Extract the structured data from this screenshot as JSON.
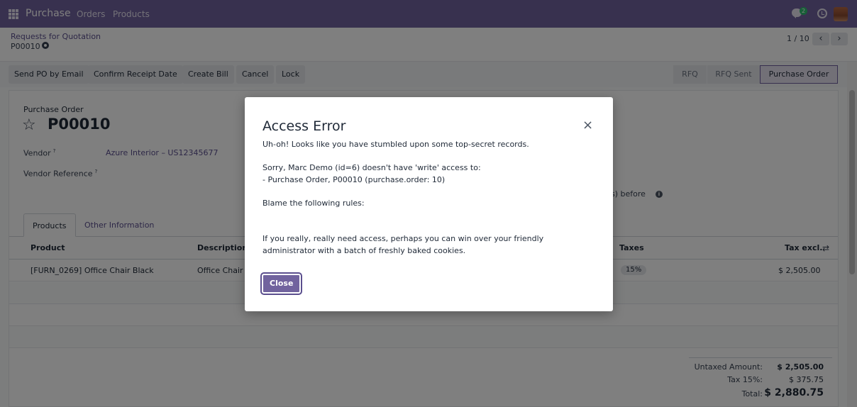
{
  "navbar": {
    "brand": "Purchase",
    "menu": [
      "Orders",
      "Products"
    ],
    "chat_count": "2"
  },
  "control_panel": {
    "breadcrumb": "Requests for Quotation",
    "record_name": "P00010",
    "pager": "1 / 10",
    "prev": "‹",
    "next": "›"
  },
  "statusbar": {
    "buttons": [
      "Send PO by Email",
      "Confirm Receipt Date",
      "Create Bill",
      "Cancel",
      "Lock"
    ],
    "stages": [
      "RFQ",
      "RFQ Sent",
      "Purchase Order"
    ]
  },
  "form": {
    "subtitle": "Purchase Order",
    "title": "P00010",
    "vendor_label": "Vendor",
    "vendor_value": "Azure Interior – US12345677",
    "vendor_ref_label": "Vendor Reference",
    "help_mark": "?",
    "partial_text": "s) before",
    "info_glyph": "i"
  },
  "tabs": [
    "Products",
    "Other Information"
  ],
  "table": {
    "headers": [
      "Product",
      "Description",
      "Taxes",
      "Tax excl."
    ],
    "rows": [
      {
        "product": "[FURN_0269] Office Chair Black",
        "description": "Office Chair B",
        "taxes": "15%",
        "amount": "$ 2,505.00"
      }
    ]
  },
  "totals": {
    "untaxed_label": "Untaxed Amount:",
    "untaxed_value": "$ 2,505.00",
    "tax_label": "Tax 15%:",
    "tax_value": "$ 375.75",
    "total_label": "Total:",
    "total_value": "$ 2,880.75"
  },
  "modal": {
    "title": "Access Error",
    "close_icon": "×",
    "line1": "Uh-oh! Looks like you have stumbled upon some top-secret records.",
    "line2": "Sorry, Marc Demo (id=6) doesn't have 'write' access to:",
    "line3": "- Purchase Order, P00010 (purchase.order: 10)",
    "line4": "Blame the following rules:",
    "line5": "If you really, really need access, perhaps you can win over your friendly administrator with a batch of freshly baked cookies.",
    "close_label": "Close"
  },
  "icons": {
    "apps": "apps-grid-icon",
    "chat": "chat-icon",
    "clock": "clock-icon",
    "gear": "gear-icon",
    "star": "star-icon",
    "adjust": "sliders-icon"
  },
  "colors": {
    "navbar": "#71639e",
    "accent": "#5b4f8e"
  }
}
